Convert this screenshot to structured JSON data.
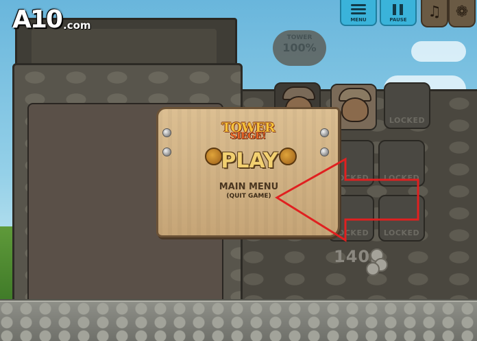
{
  "branding": {
    "logo": "A10",
    "logo_suffix": ".com"
  },
  "top_bar": {
    "menu_label": "MENU",
    "pause_label": "PAUSE",
    "music_icon": "music-note-icon",
    "sound_icon": "sound-swirl-icon"
  },
  "tower": {
    "label": "TOWER",
    "health": "100%"
  },
  "units": [
    {
      "state": "unlocked",
      "icon": "warrior-icon"
    },
    {
      "state": "unlocked",
      "icon": "viking-icon"
    },
    {
      "state": "locked",
      "label": "LOCKED"
    },
    {
      "state": "locked",
      "label": "LOCKED"
    },
    {
      "state": "locked",
      "label": "LOCKED"
    },
    {
      "state": "locked",
      "label": "LOCKED"
    },
    {
      "state": "locked",
      "label": "LOCKED"
    }
  ],
  "coins": "1403",
  "sign": {
    "game_logo_line1": "TOWER",
    "game_logo_line2": "SIEGE!",
    "play_label": "PLAY",
    "main_menu_label": "MAIN MENU",
    "quit_label": "(QUIT GAME)"
  },
  "annotation": {
    "color": "#e02020"
  }
}
